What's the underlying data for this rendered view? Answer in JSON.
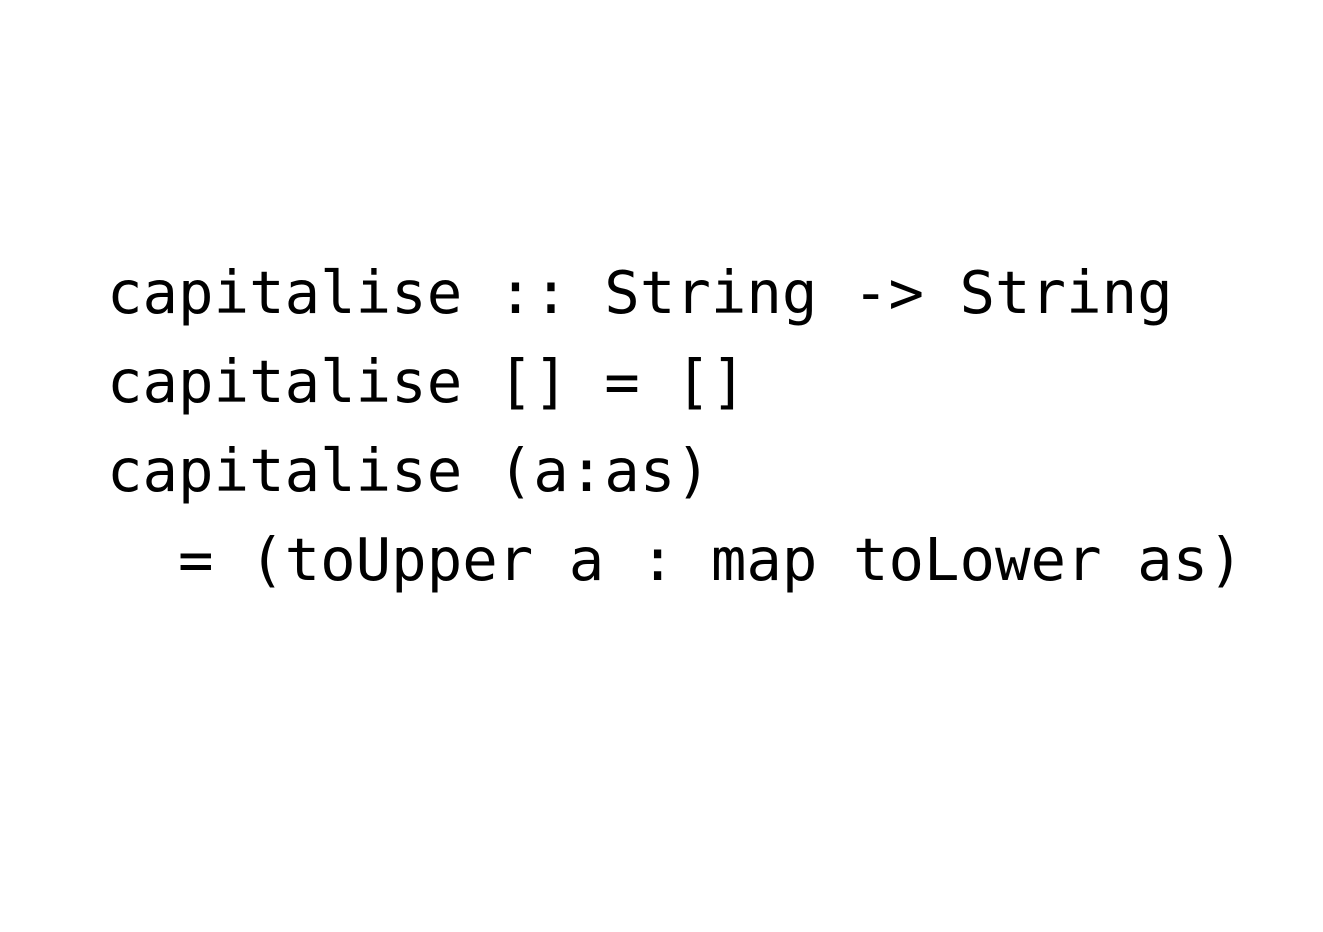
{
  "code": {
    "lines": [
      "capitalise :: String -> String",
      "capitalise [] = []",
      "capitalise (a:as)",
      "  = (toUpper a : map toLower as)"
    ]
  },
  "colors": {
    "background": "#ffffff",
    "text": "#000000"
  }
}
